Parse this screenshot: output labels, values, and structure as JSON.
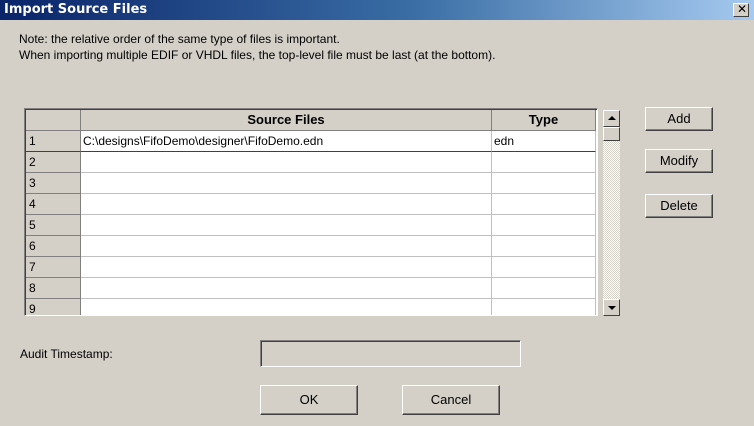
{
  "window": {
    "title": "Import Source Files",
    "close_glyph": "✕"
  },
  "note": {
    "line1": "Note: the relative order of the same type of files is important.",
    "line2": "When importing multiple EDIF or VHDL files, the top-level file must be last (at the bottom)."
  },
  "table": {
    "columns": {
      "source": "Source Files",
      "type": "Type"
    },
    "rows": [
      {
        "num": "1",
        "source": "C:\\designs\\FifoDemo\\designer\\FifoDemo.edn",
        "type": "edn"
      },
      {
        "num": "2",
        "source": "",
        "type": ""
      },
      {
        "num": "3",
        "source": "",
        "type": ""
      },
      {
        "num": "4",
        "source": "",
        "type": ""
      },
      {
        "num": "5",
        "source": "",
        "type": ""
      },
      {
        "num": "6",
        "source": "",
        "type": ""
      },
      {
        "num": "7",
        "source": "",
        "type": ""
      },
      {
        "num": "8",
        "source": "",
        "type": ""
      },
      {
        "num": "9",
        "source": "",
        "type": ""
      }
    ]
  },
  "actions": {
    "add": "Add",
    "modify": "Modify",
    "delete": "Delete"
  },
  "audit": {
    "label": "Audit Timestamp:",
    "value": ""
  },
  "footer": {
    "ok": "OK",
    "cancel": "Cancel"
  },
  "icons": {
    "scroll_up": "scroll-up-arrow-icon",
    "scroll_down": "scroll-down-arrow-icon"
  }
}
